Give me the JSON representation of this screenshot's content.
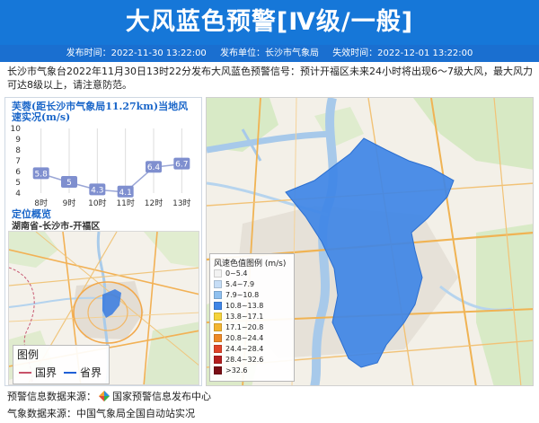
{
  "header": {
    "title": "大风蓝色预警[Ⅳ级/一般]",
    "publish_time": "发布时间：2022-11-30 13:22:00",
    "publisher": "发布单位：长沙市气象局",
    "expire_time": "失效时间：2022-12-01 13:22:00"
  },
  "description": "长沙市气象台2022年11月30日13时22分发布大风蓝色预警信号：预计开福区未来24小时将出现6～7级大风，最大风力可达8级以上，请注意防范。",
  "wind_panel": {
    "title": "芙蓉(距长沙市气象局11.27km)当地风速实况(m/s)"
  },
  "chart_data": {
    "type": "line",
    "title": "芙蓉(距长沙市气象局11.27km)当地风速实况(m/s)",
    "categories": [
      "8时",
      "9时",
      "10时",
      "11时",
      "12时",
      "13时"
    ],
    "values": [
      5.8,
      5,
      4.3,
      4.1,
      6.4,
      6.7
    ],
    "value_labels": [
      "5.8",
      "5",
      "4.3",
      "4.1",
      "6.4",
      "6.7"
    ],
    "y_ticks": [
      "10",
      "9",
      "8",
      "7",
      "6",
      "5",
      "4"
    ],
    "ylim": [
      4,
      10
    ],
    "grid": true,
    "colors": {
      "line": "#9aa6d6",
      "label_bg": "#7f8fcf",
      "grid": "#dddddd"
    }
  },
  "location": {
    "title": "定位概览",
    "path": "湖南省-长沙市-开福区"
  },
  "minimap_legend": {
    "title": "图例",
    "items": [
      {
        "label": "国界",
        "color": "#c8526a"
      },
      {
        "label": "省界",
        "color": "#1f5fd6"
      }
    ]
  },
  "wind_legend": {
    "title": "风速色值图例 (m/s)",
    "items": [
      {
        "label": "0~5.4",
        "color": "#f2f2f2"
      },
      {
        "label": "5.4~7.9",
        "color": "#c6ddf6"
      },
      {
        "label": "7.9~10.8",
        "color": "#8fc0ef"
      },
      {
        "label": "10.8~13.8",
        "color": "#3f86e6"
      },
      {
        "label": "13.8~17.1",
        "color": "#f5d33a"
      },
      {
        "label": "17.1~20.8",
        "color": "#f3b531"
      },
      {
        "label": "20.8~24.4",
        "color": "#ee8a27"
      },
      {
        "label": "24.4~28.4",
        "color": "#e0452a"
      },
      {
        "label": "28.4~32.6",
        "color": "#b41f1f"
      },
      {
        "label": ">32.6",
        "color": "#7a0f14"
      }
    ]
  },
  "footer": {
    "warning_source_label": "预警信息数据来源：",
    "warning_source": "国家预警信息发布中心",
    "weather_source": "气象数据来源：中国气象局全国自动站实况"
  },
  "colors": {
    "header_bg": "#1677d8",
    "accent": "#1a66c9",
    "warning_area": "#3f86e6"
  }
}
